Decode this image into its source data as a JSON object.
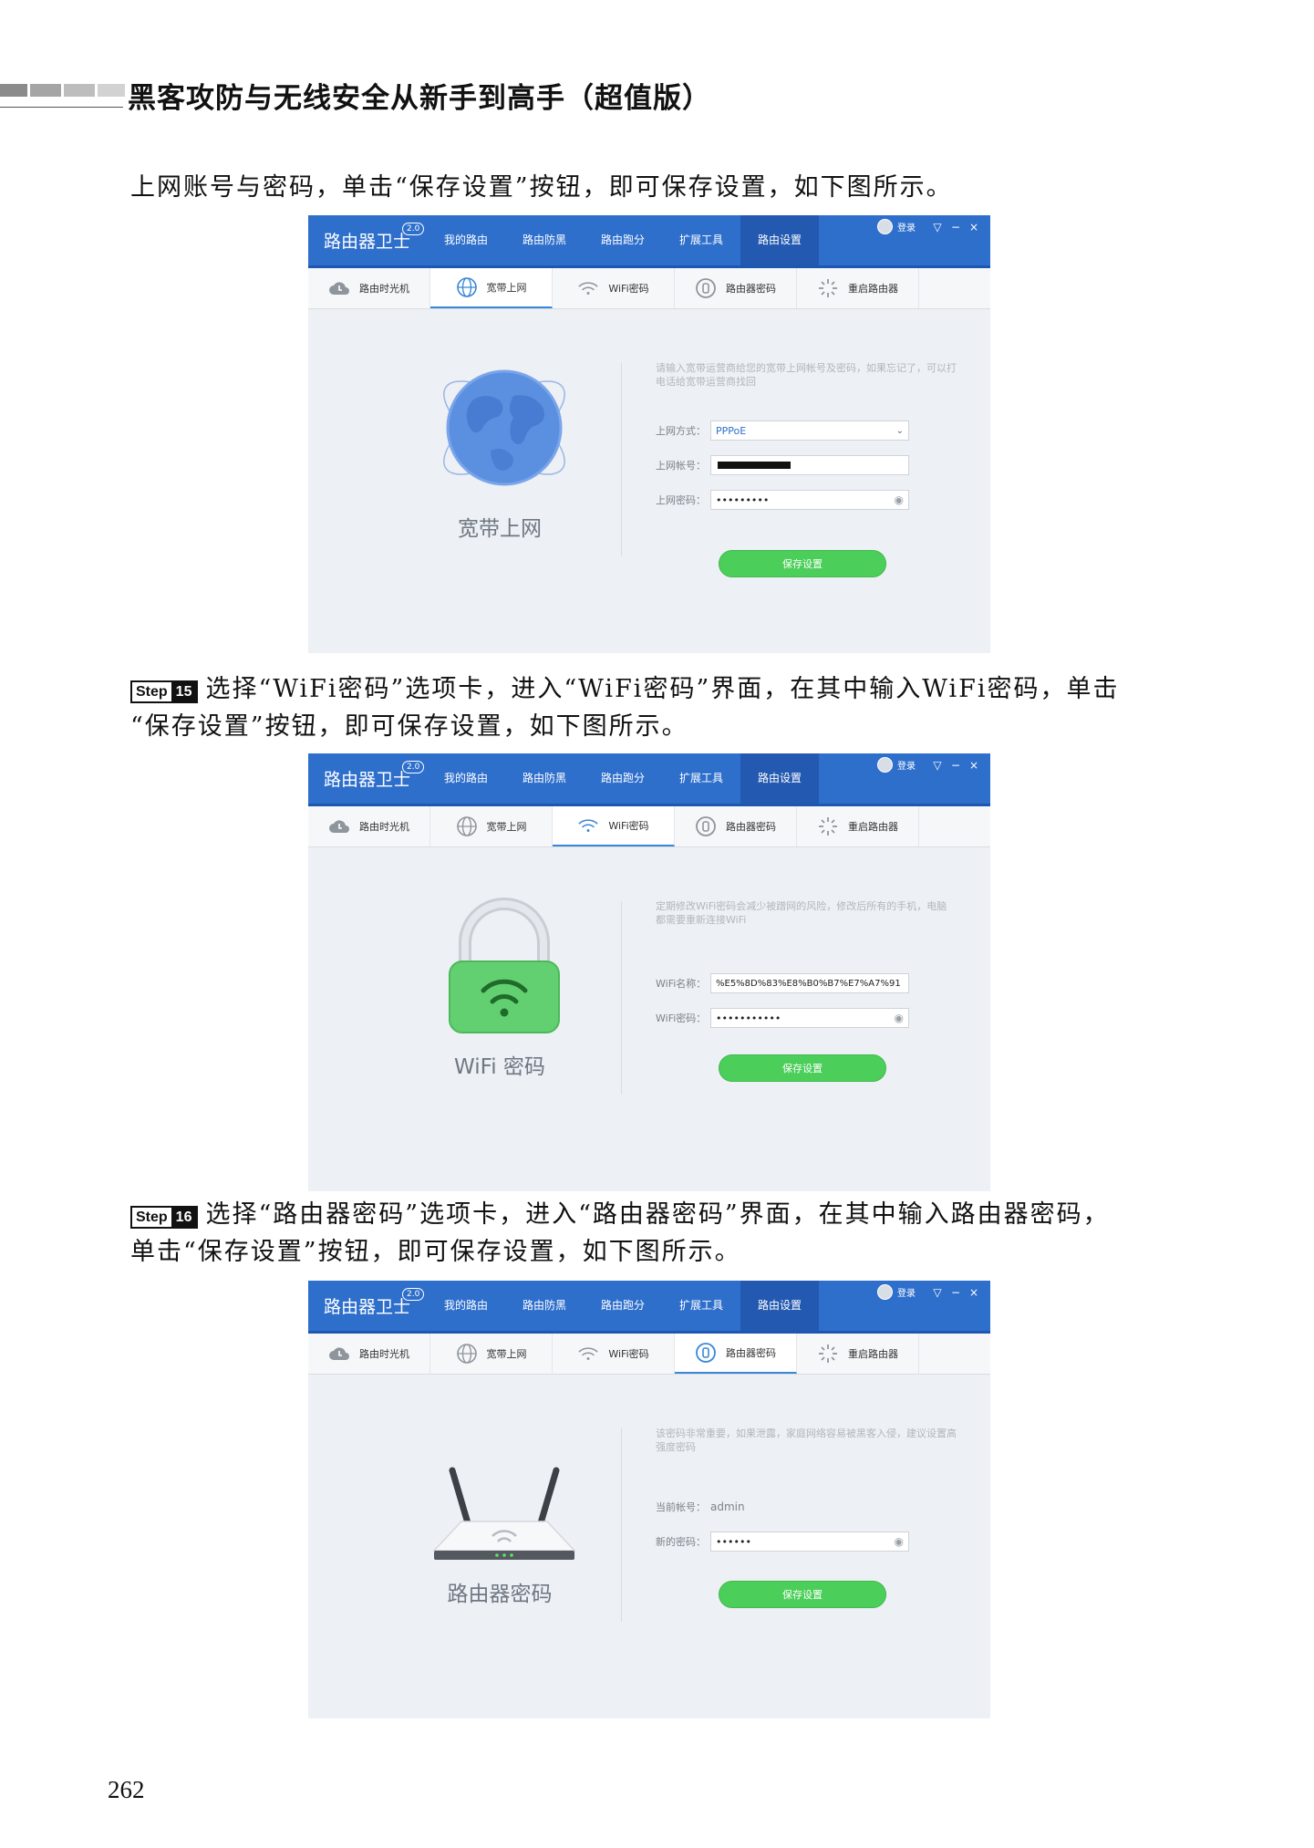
{
  "header": {
    "book_title": "黑客攻防与无线安全从新手到高手（超值版）",
    "decor_colors": [
      "#8b8b8b",
      "#a5a5a5",
      "#bdbdbd",
      "#d2d2d2"
    ]
  },
  "paragraphs": [
    {
      "lines": [
        "上网账号与密码，单击“保存设置”按钮，即可保存设置，如下图所示。"
      ]
    },
    {
      "step_label": "Step",
      "step_num": "15",
      "lines": [
        "选择“WiFi密码”选项卡，进入“WiFi密码”界面，在其中输入WiFi密码，单击",
        "“保存设置”按钮，即可保存设置，如下图所示。"
      ]
    },
    {
      "step_label": "Step",
      "step_num": "16",
      "lines": [
        "选择“路由器密码”选项卡，进入“路由器密码”界面，在其中输入路由器密码，",
        "单击“保存设置”按钮，即可保存设置，如下图所示。"
      ]
    }
  ],
  "app_common": {
    "brand": "路由器卫士",
    "version": "2.0",
    "nav": [
      "我的路由",
      "路由防黑",
      "路由跑分",
      "扩展工具",
      "路由设置"
    ],
    "active_nav": 4,
    "login": "登录",
    "window_controls": [
      "▽",
      "−",
      "×"
    ],
    "tabs": [
      {
        "label": "路由时光机",
        "icon": "cloud-icon"
      },
      {
        "label": "宽带上网",
        "icon": "globe-icon"
      },
      {
        "label": "WiFi密码",
        "icon": "wifi-icon"
      },
      {
        "label": "路由器密码",
        "icon": "lock-badge-icon"
      },
      {
        "label": "重启路由器",
        "icon": "restart-icon"
      }
    ],
    "save_label": "保存设置"
  },
  "screens": [
    {
      "active_tab": 1,
      "illustration": "globe-icon",
      "illus_label": "宽带上网",
      "hint": "请输入宽带运营商给您的宽带上网帐号及密码，如果忘记了，可以打电话给宽带运营商找回",
      "fields": [
        {
          "label": "上网方式：",
          "value": "PPPoE",
          "kind": "select"
        },
        {
          "label": "上网帐号：",
          "value": "",
          "kind": "masked"
        },
        {
          "label": "上网密码：",
          "value": "•••••••••",
          "kind": "password"
        }
      ]
    },
    {
      "active_tab": 2,
      "illustration": "padlock-wifi-icon",
      "illus_label": "WiFi 密码",
      "hint": "定期修改WiFi密码会减少被蹭网的风险，修改后所有的手机，电脑都需要重新连接WiFi",
      "fields": [
        {
          "label": "WiFi名称：",
          "value": "%E5%8D%83%E8%B0%B7%E7%A7%91",
          "kind": "text"
        },
        {
          "label": "WiFi密码：",
          "value": "•••••••••••",
          "kind": "password"
        }
      ]
    },
    {
      "active_tab": 3,
      "illustration": "router-icon",
      "illus_label": "路由器密码",
      "hint": "该密码非常重要，如果泄露，家庭网络容易被黑客入侵，建议设置高强度密码",
      "fields": [
        {
          "label": "当前帐号：",
          "value": "admin",
          "kind": "plain"
        },
        {
          "label": "新的密码：",
          "value": "••••••",
          "kind": "password"
        }
      ]
    }
  ],
  "page_number": "262"
}
